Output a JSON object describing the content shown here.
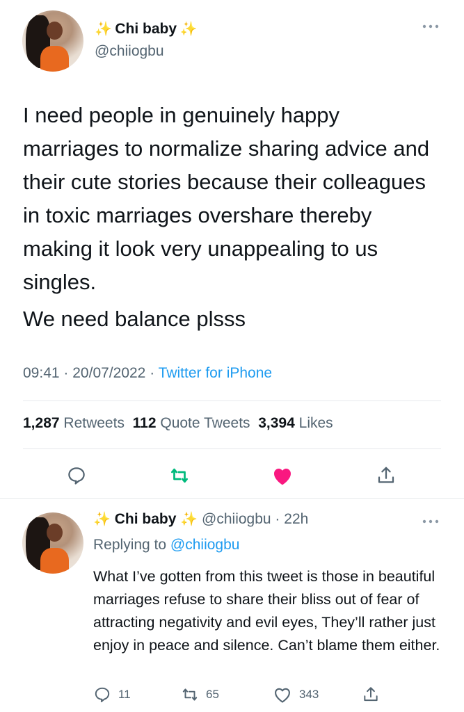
{
  "main_tweet": {
    "name_sparkle_left": "✨",
    "display_name": "Chi baby",
    "name_sparkle_right": "✨",
    "handle": "@chiiogbu",
    "more_icon": "ellipsis-icon",
    "paragraph_1": "I need people in genuinely happy marriages to normalize sharing advice and their cute stories because their colleagues in toxic marriages overshare thereby making it look very unappealing to us singles.",
    "paragraph_2": "We need balance plsss",
    "time": "09:41",
    "date": "20/07/2022",
    "separator": "·",
    "source": "Twitter for iPhone",
    "retweets_count": "1,287",
    "retweets_label": "Retweets",
    "quotes_count": "112",
    "quotes_label": "Quote Tweets",
    "likes_count": "3,394",
    "likes_label": "Likes",
    "actions": [
      "reply-icon",
      "retweet-icon",
      "like-icon",
      "share-icon"
    ],
    "liked": true
  },
  "reply_tweet": {
    "name_sparkle_left": "✨",
    "display_name": "Chi baby",
    "name_sparkle_right": "✨",
    "handle": "@chiiogbu",
    "separator": "·",
    "age": "22h",
    "replying_prefix": "Replying to",
    "replying_handle": "@chiiogbu",
    "text": "What I’ve gotten from this tweet is those in beautiful marriages refuse to share their bliss out of fear of attracting negativity and evil eyes, They’ll rather just enjoy in peace and silence.  Can’t blame them either.",
    "replies": "11",
    "retweets": "65",
    "likes": "343"
  },
  "colors": {
    "accent": "#1d9bf0",
    "like": "#f91880",
    "retweet_active": "#00ba7c",
    "muted": "#536471"
  }
}
